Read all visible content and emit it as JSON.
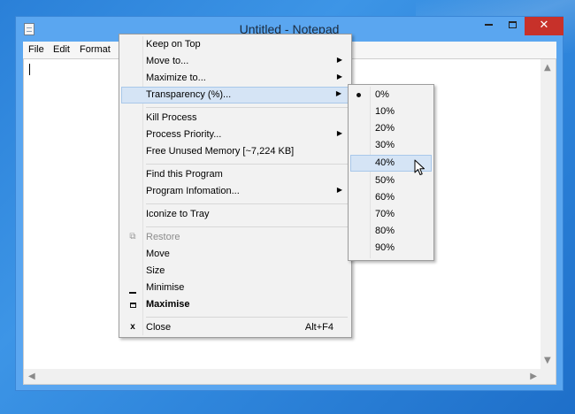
{
  "window": {
    "title": "Untitled - Notepad",
    "close_glyph": "✕",
    "icons": {
      "app": "notepad-icon",
      "minimize": "minimize-icon",
      "maximize": "maximize-icon",
      "close": "close-icon"
    }
  },
  "menubar": {
    "items": [
      "File",
      "Edit",
      "Format"
    ]
  },
  "context_menu": {
    "items": [
      {
        "label": "Keep on Top"
      },
      {
        "label": "Move to...",
        "submenu": true
      },
      {
        "label": "Maximize to...",
        "submenu": true
      },
      {
        "label": "Transparency (%)...",
        "submenu": true,
        "highlighted": true
      },
      {
        "label": "Kill Process"
      },
      {
        "label": "Process Priority...",
        "submenu": true
      },
      {
        "label": "Free Unused Memory [~7,224 KB]"
      },
      {
        "label": "Find this Program"
      },
      {
        "label": "Program Infomation...",
        "submenu": true
      },
      {
        "label": "Iconize to Tray"
      },
      {
        "label": "Restore",
        "disabled": true,
        "icon": "restore-icon"
      },
      {
        "label": "Move"
      },
      {
        "label": "Size"
      },
      {
        "label": "Minimise",
        "icon": "minimize-icon"
      },
      {
        "label": "Maximise",
        "bold": true,
        "icon": "maximize-icon"
      },
      {
        "label": "Close",
        "shortcut": "Alt+F4",
        "icon": "close-icon"
      }
    ],
    "submenu_arrow": "▶"
  },
  "transparency_submenu": {
    "options": [
      "0%",
      "10%",
      "20%",
      "30%",
      "40%",
      "50%",
      "60%",
      "70%",
      "80%",
      "90%"
    ],
    "selected": "0%",
    "hovered": "40%"
  },
  "colors": {
    "close_button": "#c7312a",
    "highlight": "#d5e4f5",
    "desktop": "#2f86dc"
  }
}
